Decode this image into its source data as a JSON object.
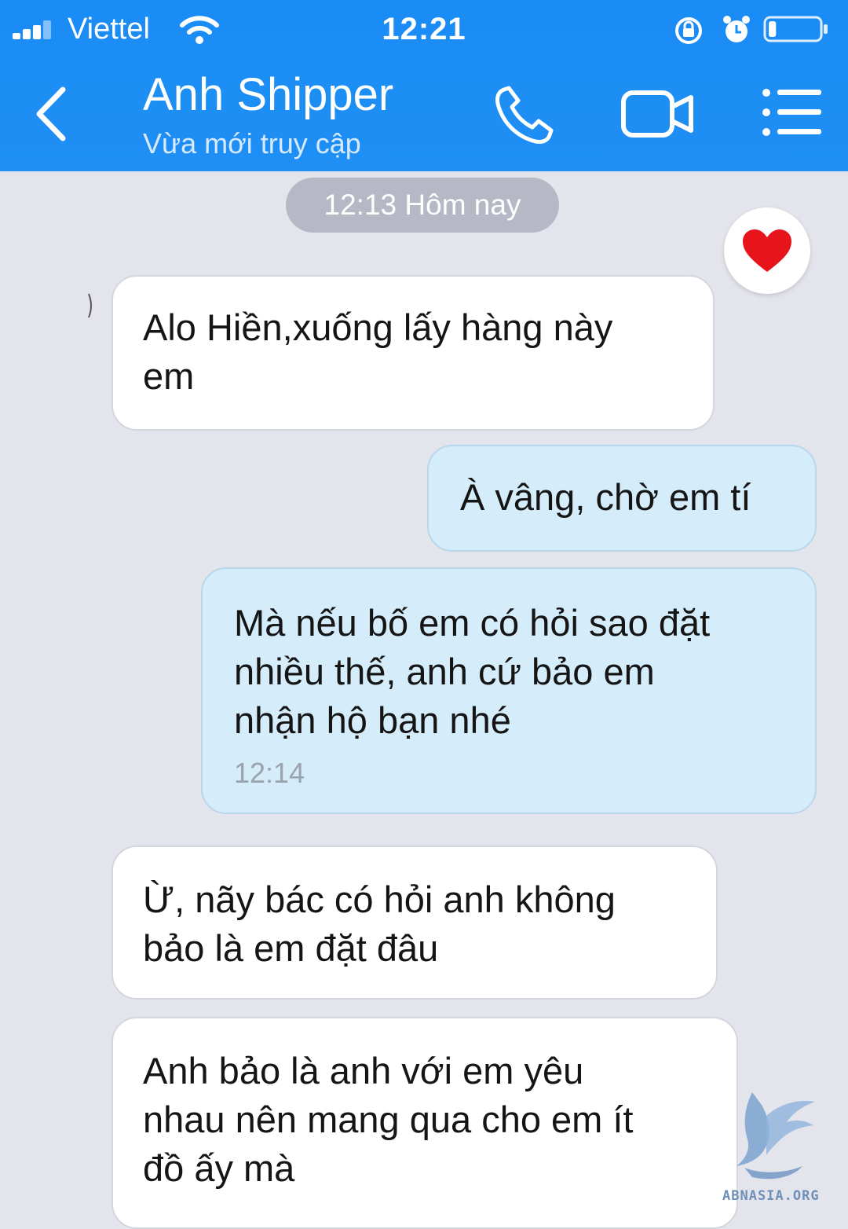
{
  "status_bar": {
    "carrier": "Viettel",
    "time": "12:21",
    "icons": [
      "signal-icon",
      "wifi-icon",
      "orientation-lock-icon",
      "alarm-icon",
      "battery-icon"
    ],
    "battery_level": 0.15
  },
  "header": {
    "contact_name": "Anh Shipper",
    "contact_status": "Vừa mới truy cập",
    "icons": [
      "back-chevron-icon",
      "phone-icon",
      "video-camera-icon",
      "menu-list-icon"
    ],
    "background_color": "#1a8cf5"
  },
  "chat": {
    "date_separator": "12:13 Hôm nay",
    "reaction": "heart-icon",
    "messages": [
      {
        "direction": "incoming",
        "text": "Alo Hiền,xuống lấy hàng này\nem"
      },
      {
        "direction": "outgoing",
        "text": "À vâng, chờ em tí"
      },
      {
        "direction": "outgoing",
        "text": "Mà nếu bố em có hỏi sao đặt\nnhiều thế, anh cứ bảo em\nnhận hộ bạn nhé",
        "time": "12:14"
      },
      {
        "direction": "incoming",
        "text": "Ừ, nãy bác có hỏi anh không\nbảo là em đặt đâu"
      },
      {
        "direction": "incoming",
        "text": "Anh bảo là anh với em yêu\nnhau nên mang qua cho em ít\nđồ ấy mà"
      }
    ],
    "incoming_bubble_color": "#ffffff",
    "outgoing_bubble_color": "#d5ecfb"
  },
  "watermark": {
    "text": "ABNASIA.ORG",
    "icon": "dragon-logo-icon"
  }
}
